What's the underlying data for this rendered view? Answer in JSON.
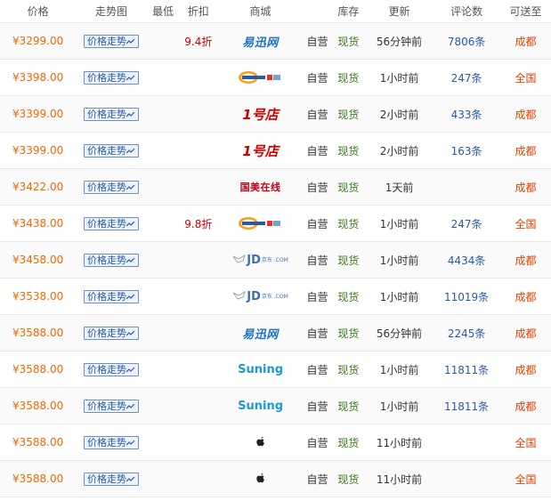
{
  "header": {
    "price": "价格",
    "trend": "走势图",
    "lowest": "最低",
    "discount": "折扣",
    "store": "商城",
    "self_operated": "",
    "stock": "库存",
    "updated": "更新",
    "reviews": "评论数",
    "ship_to": "可送至"
  },
  "trend_label": "价格走势",
  "rows": [
    {
      "price": "¥3299.00",
      "discount": "9.4折",
      "store": "yixun",
      "store_text": "易迅网",
      "self": "自营",
      "stock": "现货",
      "updated": "56分钟前",
      "reviews": "7806条",
      "ship": "成都"
    },
    {
      "price": "¥3398.00",
      "discount": "",
      "store": "newegg",
      "store_text": "newegg",
      "self": "自营",
      "stock": "现货",
      "updated": "1小时前",
      "reviews": "247条",
      "ship": "全国"
    },
    {
      "price": "¥3399.00",
      "discount": "",
      "store": "yhd",
      "store_text": "1号店",
      "self": "自营",
      "stock": "现货",
      "updated": "2小时前",
      "reviews": "433条",
      "ship": "成都"
    },
    {
      "price": "¥3399.00",
      "discount": "",
      "store": "yhd",
      "store_text": "1号店",
      "self": "自营",
      "stock": "现货",
      "updated": "2小时前",
      "reviews": "163条",
      "ship": "成都"
    },
    {
      "price": "¥3422.00",
      "discount": "",
      "store": "gome",
      "store_text": "国美在线",
      "self": "自营",
      "stock": "现货",
      "updated": "1天前",
      "reviews": "",
      "ship": "成都"
    },
    {
      "price": "¥3438.00",
      "discount": "9.8折",
      "store": "newegg",
      "store_text": "newegg",
      "self": "自营",
      "stock": "现货",
      "updated": "1小时前",
      "reviews": "247条",
      "ship": "全国"
    },
    {
      "price": "¥3458.00",
      "discount": "",
      "store": "jd",
      "store_text": "JD",
      "store_sub": "京东 .COM",
      "self": "自营",
      "stock": "现货",
      "updated": "1小时前",
      "reviews": "4434条",
      "ship": "成都"
    },
    {
      "price": "¥3538.00",
      "discount": "",
      "store": "jd",
      "store_text": "JD",
      "store_sub": "京东 .COM",
      "self": "自营",
      "stock": "现货",
      "updated": "1小时前",
      "reviews": "11019条",
      "ship": "成都"
    },
    {
      "price": "¥3588.00",
      "discount": "",
      "store": "yixun",
      "store_text": "易迅网",
      "self": "自营",
      "stock": "现货",
      "updated": "56分钟前",
      "reviews": "2245条",
      "ship": "成都"
    },
    {
      "price": "¥3588.00",
      "discount": "",
      "store": "suning",
      "store_text": "Suning",
      "self": "自营",
      "stock": "现货",
      "updated": "1小时前",
      "reviews": "11811条",
      "ship": "成都"
    },
    {
      "price": "¥3588.00",
      "discount": "",
      "store": "suning",
      "store_text": "Suning",
      "self": "自营",
      "stock": "现货",
      "updated": "1小时前",
      "reviews": "11811条",
      "ship": "成都"
    },
    {
      "price": "¥3588.00",
      "discount": "",
      "store": "apple",
      "store_text": "",
      "self": "自营",
      "stock": "现货",
      "updated": "11小时前",
      "reviews": "",
      "ship": "全国"
    },
    {
      "price": "¥3588.00",
      "discount": "",
      "store": "apple",
      "store_text": "",
      "self": "自营",
      "stock": "现货",
      "updated": "11小时前",
      "reviews": "",
      "ship": "全国"
    }
  ],
  "colors": {
    "price": "#f56600",
    "discount": "#d00000",
    "stock": "#3a7d1a",
    "reviews": "#2a59a8",
    "ship": "#e04200",
    "trend_border": "#6d8fc7"
  },
  "icons": {
    "trend": "trend-line-icon",
    "apple": "apple-logo-icon",
    "newegg": "newegg-logo",
    "jd": "jd-dog-logo"
  }
}
